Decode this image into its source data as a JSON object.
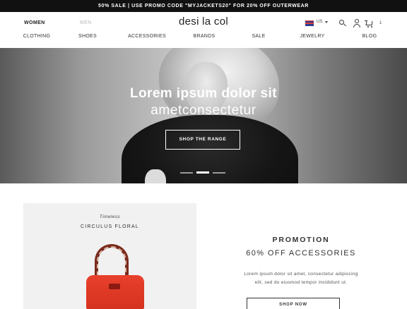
{
  "promo_bar": {
    "text": "50% SALE | USE PROMO CODE \"MYJACKETS20\" FOR 20% OFF OUTERWEAR"
  },
  "header": {
    "gender_tabs": [
      {
        "label": "WOMEN"
      },
      {
        "label": "MEN"
      }
    ],
    "brand": "desi la col",
    "locale": "US",
    "cart_count": "1",
    "icons": [
      "flag-us-icon",
      "chevron-down-icon",
      "search-icon",
      "user-icon",
      "cart-icon"
    ]
  },
  "nav": {
    "items": [
      {
        "label": "CLOTHING"
      },
      {
        "label": "SHOES"
      },
      {
        "label": "ACCESSORIES"
      },
      {
        "label": "BRANDS"
      },
      {
        "label": "SALE"
      },
      {
        "label": "JEWELRY"
      },
      {
        "label": "BLOG"
      }
    ]
  },
  "hero": {
    "title": "Lorem ipsum dolor sit",
    "subtitle": "ametconsectetur",
    "button_label": "SHOP THE RANGE",
    "slides": 3,
    "active_slide": 2
  },
  "promo_card": {
    "tag": "Timeless",
    "title": "CIRCULUS FLORAL"
  },
  "promotion": {
    "heading": "PROMOTION",
    "subheading": "60% OFF ACCESSORIES",
    "body_line1": "Lorem ipsum dolor sit amet, consectetur adipiscing",
    "body_line2": "elit, sed do eiusmod tempor incididunt ut.",
    "button_label": "SHOP NOW"
  },
  "colors": {
    "promo_bar_bg": "#111111",
    "bag_red": "#e8402c",
    "card_bg": "#f1f1f1"
  }
}
